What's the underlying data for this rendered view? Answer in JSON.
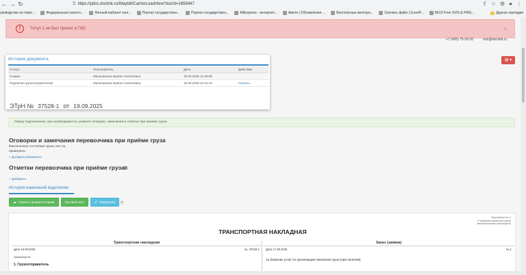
{
  "browser": {
    "url": "https://pdoc.doclink.ru/Waybill/CarrierLoadView?docId=1659447",
    "bookmarks": [
      "уководство по пере...",
      "Федеральная налого...",
      "Личный кабинет нал...",
      "Портал государствен...",
      "Портал государствен...",
      "AliExpress - интернет...",
      "Авито | Объявления ...",
      "Бесплатные векторн...",
      "Скачать файл | iLoveP...",
      "8613 Free SVG & PNG..."
    ],
    "other_bookmarks": "Другие закладки"
  },
  "alert": {
    "text": "Титул 1 не был принят в ГИС"
  },
  "contacts": {
    "phone": "+7 (495) 75-39-20",
    "email": "edo@doclink.ru"
  },
  "history": {
    "title": "История документа",
    "columns": [
      "Статус",
      "Пользователь",
      "Дата",
      "Действие"
    ],
    "rows": [
      {
        "status": "Создан",
        "user": "Масинашина Ирина Алексеевна",
        "date": "19.09.2025 11:28:08",
        "action": ""
      },
      {
        "status": "Подписан грузоотправителем",
        "user": "Масинашина Ирина Алексеевна",
        "date": "19.09.2025 11:31:44",
        "action": "Скачать"
      }
    ]
  },
  "doc": {
    "prefix": "ЭТрН №",
    "number": "37528-1",
    "from": "от",
    "date": "19.09.2025"
  },
  "info": "Перед подписанием, при необходимости, укажите оговорки, замечания в отметки при приеме груза.",
  "remarks": {
    "title": "Оговорки и замечания перевозчика при приёме груза",
    "lines": [
      "Фактическое состояние груза, все ок,",
      "проверено."
    ],
    "add_link": "Добавить/Изменить"
  },
  "marks": {
    "title": "Отметки перевозчика при приёме груза",
    "add_link": "Добавить"
  },
  "driver_history": "История изменений водителем",
  "buttons": {
    "download": "Скачать документ/Архив",
    "route_sheet": "Путевой лист",
    "sign": "Подписать"
  },
  "paper": {
    "appendix": [
      "Приложение № 4",
      "к Правилам перевозок грузов",
      "автомобильным транспортом"
    ],
    "title": "ТРАНСПОРТНАЯ НАКЛАДНАЯ",
    "left": {
      "header": "Транспортная накладная",
      "date_label": "Дата 19.09.2025",
      "num_label": "№",
      "num_value": "37528-1",
      "note": "Экземпляр №",
      "section": "1. Грузоотправитель"
    },
    "right": {
      "header": "Заказ (заявка)",
      "date_label": "Дата 17.09.2025",
      "num_label": "№ 1",
      "text": "1а Заказчик услуг по организации перевозки груза (при наличии)"
    }
  }
}
